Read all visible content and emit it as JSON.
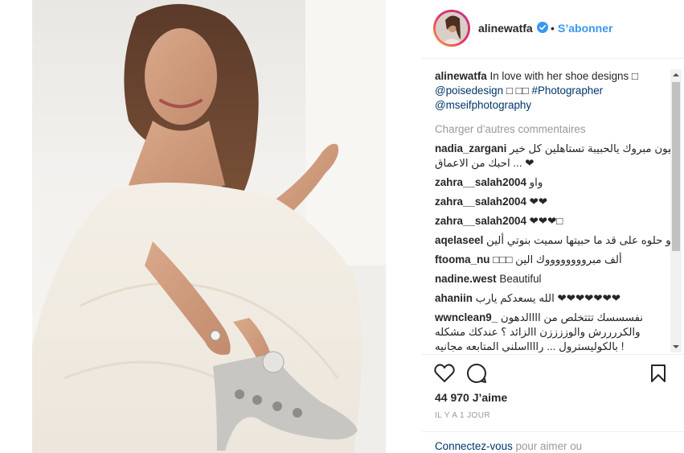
{
  "post": {
    "username": "alinewatfa",
    "follow_label": "S’abonner",
    "separator": "•"
  },
  "caption": {
    "username": "alinewatfa",
    "text": "In love with her shoe designs □",
    "mention1": "@poisedesign",
    "boxes": "□ □□",
    "hashtag": "#Photographer",
    "mention2": "@mseifphotography"
  },
  "load_more": "Charger d’autres commentaires",
  "comments": [
    {
      "user": "nadia_zargani",
      "text": "مليون مبروك يالحبيبة تستاهلين كل خير",
      "text2": "❤ ... احبك من الاعماق"
    },
    {
      "user": "zahra__salah2004",
      "text": "واو"
    },
    {
      "user": "zahra__salah2004",
      "text": "❤❤"
    },
    {
      "user": "zahra__salah2004",
      "text": "❤❤❤□"
    },
    {
      "user": "aqelaseel",
      "text": "شو حلوه على قد ما حبيتها سميت بنوتي ألين"
    },
    {
      "user": "ftooma_nu",
      "text": "ألف مبرووووووووك الين □□□"
    },
    {
      "user": "nadine.west",
      "text": "Beautiful"
    },
    {
      "user": "ahaniin",
      "text": "❤❤❤❤❤❤❤ الله يسعدكم يارب"
    },
    {
      "user": "wwnclean9_",
      "text": "نفسسسك تتتخلص من اااالدهون",
      "text2": "والكررررش والوززززن االزائد ؟ عندكك مشكله",
      "text3": "! بالكوليسترول ... رااااسلني المتابعه مجانيه"
    }
  ],
  "likes": "44 970 J’aime",
  "timestamp": "IL Y A 1 JOUR",
  "login": {
    "link": "Connectez-vous",
    "rest": " pour aimer ou"
  },
  "icons": {
    "like": "heart-icon",
    "comment": "comment-bubble-icon",
    "save": "bookmark-icon",
    "verified": "verified-badge-icon"
  },
  "colors": {
    "link_blue": "#3897f0",
    "dark_link": "#003569",
    "muted": "#999999",
    "text": "#262626"
  }
}
